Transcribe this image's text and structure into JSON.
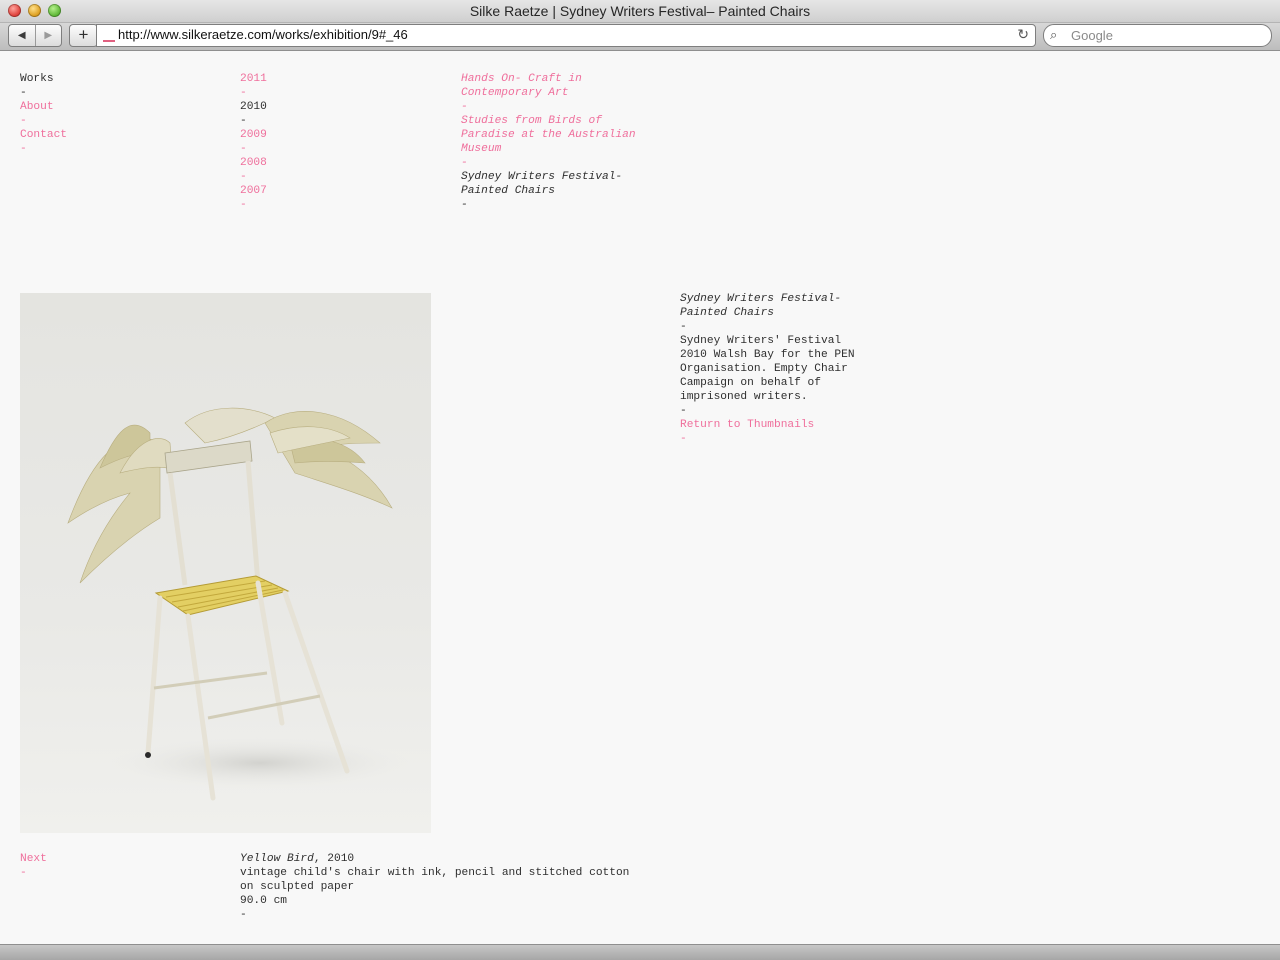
{
  "browser": {
    "window_title": "Silke Raetze | Sydney Writers Festival– Painted Chairs",
    "url": "http://www.silkeraetze.com/works/exhibition/9#_46",
    "search_placeholder": "Google",
    "back_icon": "◀",
    "forward_icon": "▶",
    "add_icon": "+",
    "reload_icon": "↻",
    "search_icon": "⌕"
  },
  "dash": "-",
  "nav": {
    "items": [
      {
        "label": "Works",
        "active": true
      },
      {
        "label": "About",
        "active": false
      },
      {
        "label": "Contact",
        "active": false
      }
    ]
  },
  "years": [
    {
      "label": "2011",
      "active": false
    },
    {
      "label": "2010",
      "active": true
    },
    {
      "label": "2009",
      "active": false
    },
    {
      "label": "2008",
      "active": false
    },
    {
      "label": "2007",
      "active": false
    }
  ],
  "exhibitions": [
    {
      "lines": [
        "Hands On- Craft in",
        "Contemporary Art"
      ],
      "active": false
    },
    {
      "lines": [
        "Studies from Birds of",
        "Paradise at the Australian",
        "Museum"
      ],
      "active": false
    },
    {
      "lines": [
        "Sydney Writers Festival-",
        "Painted Chairs"
      ],
      "active": true
    }
  ],
  "description": {
    "title_lines": [
      "Sydney Writers Festival-",
      "Painted Chairs"
    ],
    "body_lines": [
      "Sydney Writers' Festival",
      "2010 Walsh Bay for the PEN",
      "Organisation. Empty Chair",
      "Campaign on behalf of",
      "imprisoned writers."
    ],
    "return_link": "Return to Thumbnails"
  },
  "artwork": {
    "title": "Yellow Bird",
    "year": ", 2010",
    "medium_lines": [
      "vintage child's chair with ink, pencil and stitched cotton",
      "on sculpted paper"
    ],
    "size": "90.0 cm"
  },
  "pager": {
    "next_label": "Next"
  },
  "colors": {
    "link": "#ef6f9c",
    "text": "#2f2f2f",
    "background": "#f8f8f8"
  }
}
